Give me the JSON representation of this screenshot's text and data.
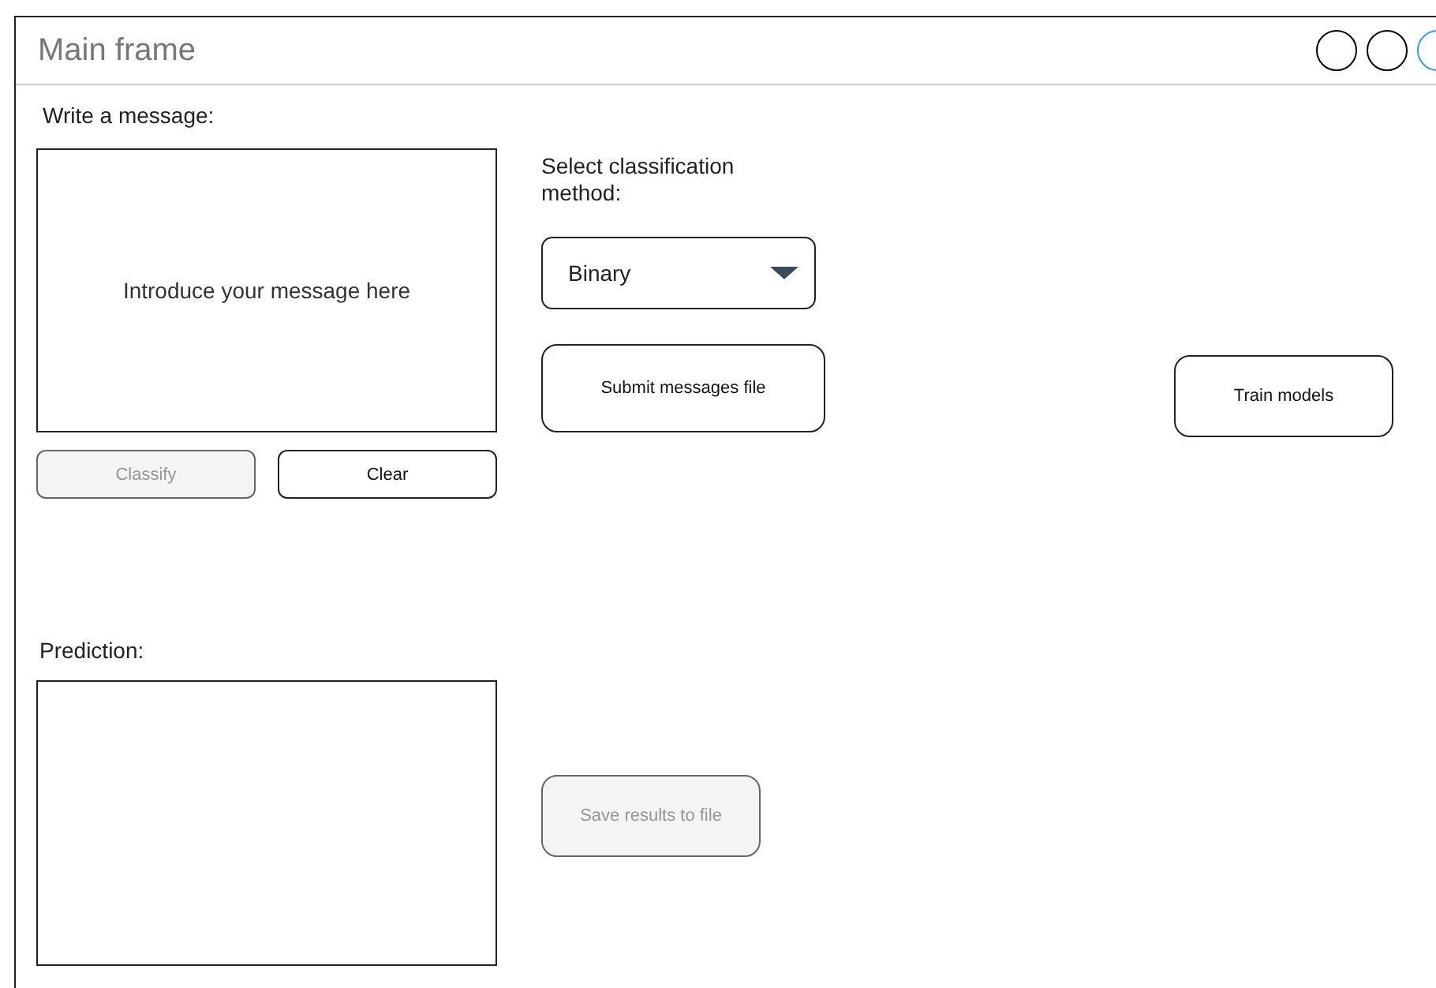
{
  "window": {
    "title": "Main frame",
    "controls": [
      {
        "color": "#000000"
      },
      {
        "color": "#000000"
      },
      {
        "color": "#3399ff"
      }
    ]
  },
  "message": {
    "label": "Write a message:",
    "placeholder": "Introduce your message here"
  },
  "message_buttons": [
    {
      "label": "Classify",
      "disabled": true
    },
    {
      "label": "Clear",
      "disabled": false
    }
  ],
  "method": {
    "label": "Select classification method:",
    "value": "Binary"
  },
  "submit_button": {
    "label": "Submit messages file",
    "disabled": false
  },
  "train_button": {
    "label": "Train models",
    "disabled": false
  },
  "prediction": {
    "label": "Prediction:"
  },
  "save_button": {
    "label": "Save results to file",
    "disabled": true
  }
}
